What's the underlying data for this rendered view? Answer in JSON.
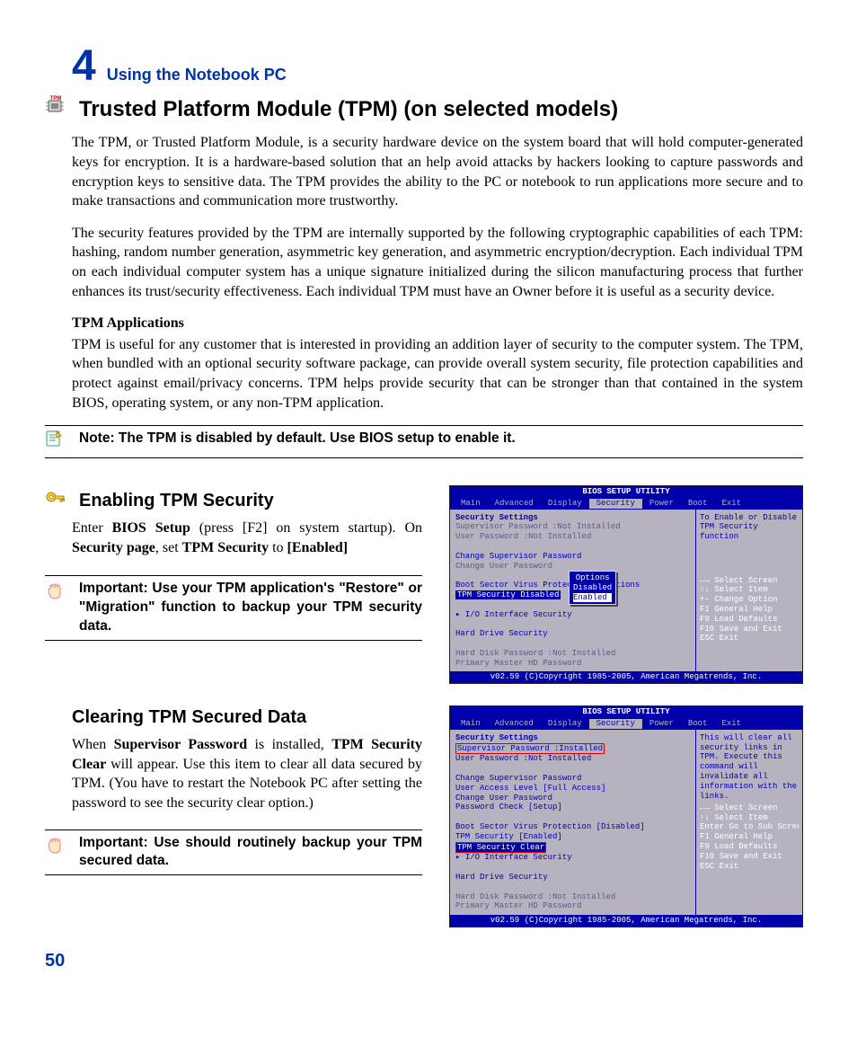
{
  "chapter": {
    "num": "4",
    "title": "Using the Notebook PC"
  },
  "section1": {
    "heading": "Trusted Platform Module (TPM) (on selected models)",
    "p1": "The TPM, or Trusted Platform Module, is a security hardware device on the system board that will hold computer-generated keys for encryption. It is a hardware-based solution that an help avoid attacks by hackers looking to capture passwords and encryption keys to sensitive data. The TPM provides the ability to the PC or notebook to run applications more secure and to make transactions and communication more trustworthy.",
    "p2": "The security features provided by the TPM are internally supported by the following cryptographic capabilities of each TPM: hashing, random number generation, asymmetric key generation, and asymmetric encryption/decryption. Each individual TPM on each individual computer system has a unique signature initialized during the silicon manufacturing process that further enhances its trust/security effectiveness. Each individual TPM must have an Owner before it is useful as a security device.",
    "subheading": "TPM Applications",
    "p3": "TPM is useful for any customer that is interested in providing an addition layer of security to the computer system. The TPM, when bundled with an optional security software package, can provide overall system security, file protection capabilities and protect against email/privacy concerns. TPM helps provide security that can be stronger than that contained in the system BIOS, operating system, or any non-TPM application.",
    "note": "Note: The TPM is disabled by default. Use BIOS setup to enable it."
  },
  "section2": {
    "heading": "Enabling TPM Security",
    "p1a": "Enter ",
    "p1b": "BIOS Setup",
    "p1c": " (press [F2] on system startup). On ",
    "p1d": "Security page",
    "p1e": ", set ",
    "p1f": "TPM Security",
    "p1g": " to ",
    "p1h": "[Enabled]",
    "callout": "Important: Use your TPM application's \"Restore\" or \"Migration\" function to backup your TPM security data."
  },
  "section3": {
    "heading": "Clearing TPM Secured Data",
    "p1a": "When ",
    "p1b": "Supervisor Password",
    "p1c": " is installed, ",
    "p1d": "TPM Security Clear",
    "p1e": " will appear. Use this item to clear all data secured by TPM. (You have to restart the Notebook PC after setting the password to see the security clear option.)",
    "callout": "Important: Use should routinely backup your TPM secured data."
  },
  "bios1": {
    "title": "BIOS SETUP UTILITY",
    "tabs": [
      "Main",
      "Advanced",
      "Display",
      "Security",
      "Power",
      "Boot",
      "Exit"
    ],
    "heading": "Security Settings",
    "lines": [
      "Supervisor Password  :Not Installed",
      "User Password        :Not Installed",
      "",
      "Change Supervisor Password",
      "Change User Password",
      "",
      "Boot Sector Virus Protection  : Options",
      "TPM Security                  Disabled",
      "                              Enabled",
      "▸ I/O Interface Security",
      "",
      "Hard Drive Security",
      "",
      "Hard Disk Password    :Not Installed",
      "Primary Master HD Password"
    ],
    "help_top": "To Enable or Disable TPM Security function",
    "help_keys": [
      "←→   Select Screen",
      "↑↓   Select Item",
      "+-   Change Option",
      "F1   General Help",
      "F9   Load Defaults",
      "F10  Save and Exit",
      "ESC  Exit"
    ],
    "footer": "v02.59 (C)Copyright 1985-2005, American Megatrends, Inc."
  },
  "bios2": {
    "title": "BIOS SETUP UTILITY",
    "tabs": [
      "Main",
      "Advanced",
      "Display",
      "Security",
      "Power",
      "Boot",
      "Exit"
    ],
    "heading": "Security Settings",
    "lines": [
      "Supervisor Password  :Installed",
      "User Password        :Not Installed",
      "",
      "Change Supervisor Password",
      "User Access Level            [Full Access]",
      "Change User Password",
      "Password Check               [Setup]",
      "",
      "Boot Sector Virus Protection [Disabled]",
      "TPM Security                 [Enabled]",
      "TPM Security Clear",
      "▸ I/O Interface Security",
      "",
      "Hard Drive Security",
      "",
      "Hard Disk Password    :Not Installed",
      "Primary Master HD Password"
    ],
    "help_top": "This will clear all security links in TPM. Execute this command will invalidate all information with the links.",
    "help_keys": [
      "←→    Select Screen",
      "↑↓    Select Item",
      "Enter Go to Sub Screen",
      "F1    General Help",
      "F9    Load Defaults",
      "F10   Save and Exit",
      "ESC   Exit"
    ],
    "footer": "v02.59 (C)Copyright 1985-2005, American Megatrends, Inc."
  },
  "page_num": "50"
}
